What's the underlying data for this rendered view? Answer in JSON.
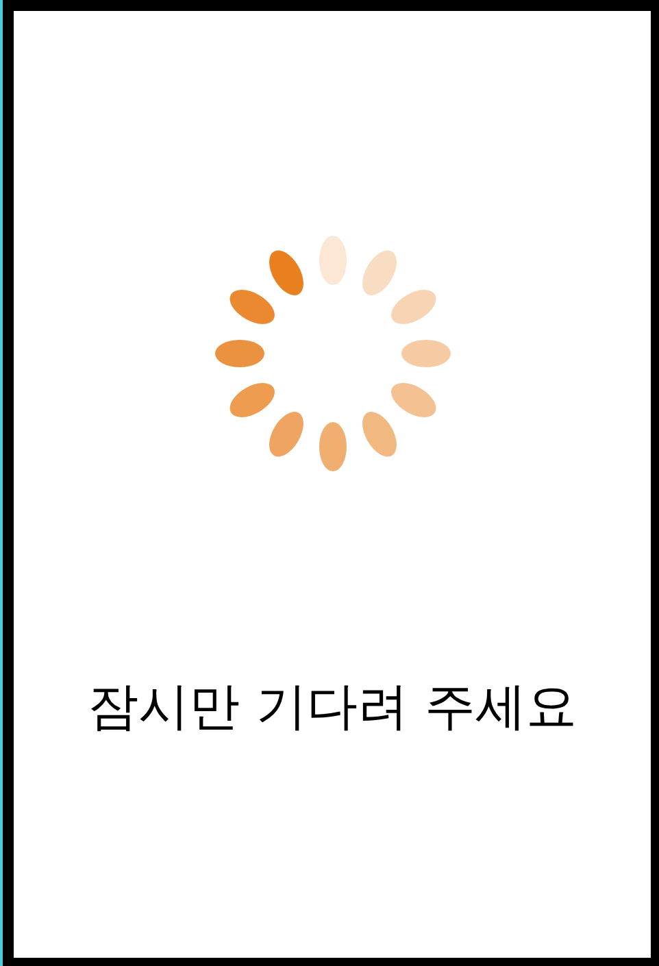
{
  "message": "잠시만 기다려 주세요"
}
